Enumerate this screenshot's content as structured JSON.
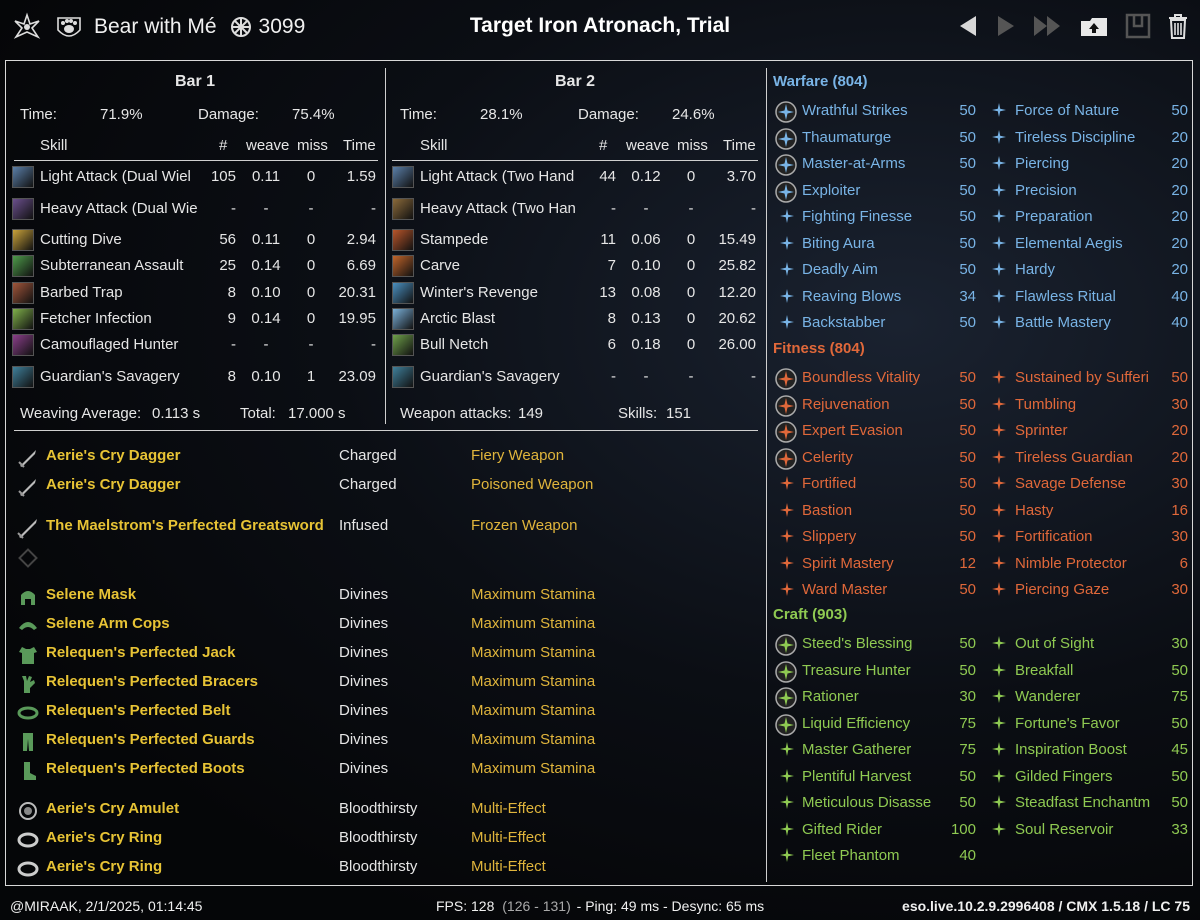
{
  "title_bar": {
    "character_name": "Bear with Mé",
    "champion_points": "3099",
    "target": "Target Iron Atronach, Trial",
    "icons": [
      "class-emblem-icon",
      "paw-icon",
      "champion-icon",
      "prev-arrow-icon",
      "next-arrow-icon",
      "skip-forward-icon",
      "upload-icon",
      "save-icon",
      "trash-icon"
    ]
  },
  "bars": [
    {
      "title": "Bar 1",
      "time_label": "Time:",
      "time_value": "71.9%",
      "damage_label": "Damage:",
      "damage_value": "75.4%",
      "headers": [
        "Skill",
        "#",
        "weave",
        "miss",
        "Time"
      ],
      "rows": [
        {
          "skill": "Light Attack (Dual Wiel",
          "count": "105",
          "weave": "0.11",
          "miss": "0",
          "time": "1.59",
          "color": "#5b7fa8"
        },
        {
          "skill": "Heavy Attack (Dual Wie",
          "count": "-",
          "weave": "-",
          "miss": "-",
          "time": "-",
          "color": "#6a4f8c"
        },
        {
          "skill": "Cutting Dive",
          "count": "56",
          "weave": "0.11",
          "miss": "0",
          "time": "2.94",
          "color": "#c9a23a"
        },
        {
          "skill": "Subterranean Assault",
          "count": "25",
          "weave": "0.14",
          "miss": "0",
          "time": "6.69",
          "color": "#4e9a4a"
        },
        {
          "skill": "Barbed Trap",
          "count": "8",
          "weave": "0.10",
          "miss": "0",
          "time": "20.31",
          "color": "#a0553a"
        },
        {
          "skill": "Fetcher Infection",
          "count": "9",
          "weave": "0.14",
          "miss": "0",
          "time": "19.95",
          "color": "#7fb04a"
        },
        {
          "skill": "Camouflaged Hunter",
          "count": "-",
          "weave": "-",
          "miss": "-",
          "time": "-",
          "color": "#8a3f8a"
        },
        {
          "skill": "Guardian's Savagery",
          "count": "8",
          "weave": "0.10",
          "miss": "1",
          "time": "23.09",
          "color": "#3f7f9a"
        }
      ],
      "footer_left_label": "Weaving Average:",
      "footer_left_value": "0.113 s",
      "footer_right_label": "Total:",
      "footer_right_value": "17.000 s"
    },
    {
      "title": "Bar 2",
      "time_label": "Time:",
      "time_value": "28.1%",
      "damage_label": "Damage:",
      "damage_value": "24.6%",
      "headers": [
        "Skill",
        "#",
        "weave",
        "miss",
        "Time"
      ],
      "rows": [
        {
          "skill": "Light Attack (Two Hand",
          "count": "44",
          "weave": "0.12",
          "miss": "0",
          "time": "3.70",
          "color": "#5b7fa8"
        },
        {
          "skill": "Heavy Attack (Two Han",
          "count": "-",
          "weave": "-",
          "miss": "-",
          "time": "-",
          "color": "#8a6a3a"
        },
        {
          "skill": "Stampede",
          "count": "11",
          "weave": "0.06",
          "miss": "0",
          "time": "15.49",
          "color": "#b8552a"
        },
        {
          "skill": "Carve",
          "count": "7",
          "weave": "0.10",
          "miss": "0",
          "time": "25.82",
          "color": "#c0642a"
        },
        {
          "skill": "Winter's Revenge",
          "count": "13",
          "weave": "0.08",
          "miss": "0",
          "time": "12.20",
          "color": "#4a8fc0"
        },
        {
          "skill": "Arctic Blast",
          "count": "8",
          "weave": "0.13",
          "miss": "0",
          "time": "20.62",
          "color": "#7ab0d8"
        },
        {
          "skill": "Bull Netch",
          "count": "6",
          "weave": "0.18",
          "miss": "0",
          "time": "26.00",
          "color": "#6fa04a"
        },
        {
          "skill": "Guardian's Savagery",
          "count": "-",
          "weave": "-",
          "miss": "-",
          "time": "-",
          "color": "#3f7f9a"
        }
      ],
      "footer_left_label": "Weapon attacks:",
      "footer_left_value": "149",
      "footer_right_label": "Skills:",
      "footer_right_value": "151"
    }
  ],
  "gear": [
    {
      "name": "Aerie's Cry Dagger",
      "trait": "Charged",
      "enchant": "Fiery Weapon",
      "icon": "dagger-icon"
    },
    {
      "name": "Aerie's Cry Dagger",
      "trait": "Charged",
      "enchant": "Poisoned Weapon",
      "icon": "dagger-icon"
    },
    {
      "name": "The Maelstrom's Perfected Greatsword",
      "trait": "Infused",
      "enchant": "Frozen Weapon",
      "icon": "greatsword-icon"
    },
    {
      "name": "",
      "trait": "",
      "enchant": "",
      "icon": "empty-slot-icon"
    },
    {
      "name": "Selene Mask",
      "trait": "Divines",
      "enchant": "Maximum Stamina",
      "icon": "helmet-icon"
    },
    {
      "name": "Selene Arm Cops",
      "trait": "Divines",
      "enchant": "Maximum Stamina",
      "icon": "shoulder-icon"
    },
    {
      "name": "Relequen's Perfected Jack",
      "trait": "Divines",
      "enchant": "Maximum Stamina",
      "icon": "chest-icon"
    },
    {
      "name": "Relequen's Perfected Bracers",
      "trait": "Divines",
      "enchant": "Maximum Stamina",
      "icon": "gloves-icon"
    },
    {
      "name": "Relequen's Perfected Belt",
      "trait": "Divines",
      "enchant": "Maximum Stamina",
      "icon": "belt-icon"
    },
    {
      "name": "Relequen's Perfected Guards",
      "trait": "Divines",
      "enchant": "Maximum Stamina",
      "icon": "legs-icon"
    },
    {
      "name": "Relequen's Perfected Boots",
      "trait": "Divines",
      "enchant": "Maximum Stamina",
      "icon": "boots-icon"
    },
    {
      "name": "Aerie's Cry Amulet",
      "trait": "Bloodthirsty",
      "enchant": "Multi-Effect",
      "icon": "amulet-icon"
    },
    {
      "name": "Aerie's Cry Ring",
      "trait": "Bloodthirsty",
      "enchant": "Multi-Effect",
      "icon": "ring-icon"
    },
    {
      "name": "Aerie's Cry Ring",
      "trait": "Bloodthirsty",
      "enchant": "Multi-Effect",
      "icon": "ring-icon"
    }
  ],
  "champion_points": [
    {
      "category": "Warfare (804)",
      "color": "#79b4e6",
      "left": [
        {
          "name": "Wrathful Strikes",
          "points": "50",
          "slotted": true
        },
        {
          "name": "Thaumaturge",
          "points": "50",
          "slotted": true
        },
        {
          "name": "Master-at-Arms",
          "points": "50",
          "slotted": true
        },
        {
          "name": "Exploiter",
          "points": "50",
          "slotted": true
        },
        {
          "name": "Fighting Finesse",
          "points": "50",
          "slotted": false
        },
        {
          "name": "Biting Aura",
          "points": "50",
          "slotted": false
        },
        {
          "name": "Deadly Aim",
          "points": "50",
          "slotted": false
        },
        {
          "name": "Reaving Blows",
          "points": "34",
          "slotted": false
        },
        {
          "name": "Backstabber",
          "points": "50",
          "slotted": false
        }
      ],
      "right": [
        {
          "name": "Force of Nature",
          "points": "50"
        },
        {
          "name": "Tireless Discipline",
          "points": "20"
        },
        {
          "name": "Piercing",
          "points": "20"
        },
        {
          "name": "Precision",
          "points": "20"
        },
        {
          "name": "Preparation",
          "points": "20"
        },
        {
          "name": "Elemental Aegis",
          "points": "20"
        },
        {
          "name": "Hardy",
          "points": "20"
        },
        {
          "name": "Flawless Ritual",
          "points": "40"
        },
        {
          "name": "Battle Mastery",
          "points": "40"
        }
      ]
    },
    {
      "category": "Fitness (804)",
      "color": "#e0683a",
      "left": [
        {
          "name": "Boundless Vitality",
          "points": "50",
          "slotted": true
        },
        {
          "name": "Rejuvenation",
          "points": "50",
          "slotted": true
        },
        {
          "name": "Expert Evasion",
          "points": "50",
          "slotted": true
        },
        {
          "name": "Celerity",
          "points": "50",
          "slotted": true
        },
        {
          "name": "Fortified",
          "points": "50",
          "slotted": false
        },
        {
          "name": "Bastion",
          "points": "50",
          "slotted": false
        },
        {
          "name": "Slippery",
          "points": "50",
          "slotted": false
        },
        {
          "name": "Spirit Mastery",
          "points": "12",
          "slotted": false
        },
        {
          "name": "Ward Master",
          "points": "50",
          "slotted": false
        }
      ],
      "right": [
        {
          "name": "Sustained by Sufferi",
          "points": "50"
        },
        {
          "name": "Tumbling",
          "points": "30"
        },
        {
          "name": "Sprinter",
          "points": "20"
        },
        {
          "name": "Tireless Guardian",
          "points": "20"
        },
        {
          "name": "Savage Defense",
          "points": "30"
        },
        {
          "name": "Hasty",
          "points": "16"
        },
        {
          "name": "Fortification",
          "points": "30"
        },
        {
          "name": "Nimble Protector",
          "points": "6"
        },
        {
          "name": "Piercing Gaze",
          "points": "30"
        }
      ]
    },
    {
      "category": "Craft (903)",
      "color": "#8fca52",
      "left": [
        {
          "name": "Steed's Blessing",
          "points": "50",
          "slotted": true
        },
        {
          "name": "Treasure Hunter",
          "points": "50",
          "slotted": true
        },
        {
          "name": "Rationer",
          "points": "30",
          "slotted": true
        },
        {
          "name": "Liquid Efficiency",
          "points": "75",
          "slotted": true
        },
        {
          "name": "Master Gatherer",
          "points": "75",
          "slotted": false
        },
        {
          "name": "Plentiful Harvest",
          "points": "50",
          "slotted": false
        },
        {
          "name": "Meticulous Disasse",
          "points": "50",
          "slotted": false
        },
        {
          "name": "Gifted Rider",
          "points": "100",
          "slotted": false
        },
        {
          "name": "Fleet Phantom",
          "points": "40",
          "slotted": false
        }
      ],
      "right": [
        {
          "name": "Out of Sight",
          "points": "30"
        },
        {
          "name": "Breakfall",
          "points": "50"
        },
        {
          "name": "Wanderer",
          "points": "75"
        },
        {
          "name": "Fortune's Favor",
          "points": "50"
        },
        {
          "name": "Inspiration Boost",
          "points": "45"
        },
        {
          "name": "Gilded Fingers",
          "points": "50"
        },
        {
          "name": "Steadfast Enchantm",
          "points": "50"
        },
        {
          "name": "Soul Reservoir",
          "points": "33"
        }
      ]
    }
  ],
  "footer": {
    "left": "@MIRAAK, 2/1/2025, 01:14:45",
    "fps_label": "FPS: 128",
    "fps_range": "(126 - 131)",
    "ping": "- Ping: 49 ms - Desync: 65 ms",
    "right": "eso.live.10.2.9.2996408 / CMX 1.5.18 / LC 75"
  }
}
